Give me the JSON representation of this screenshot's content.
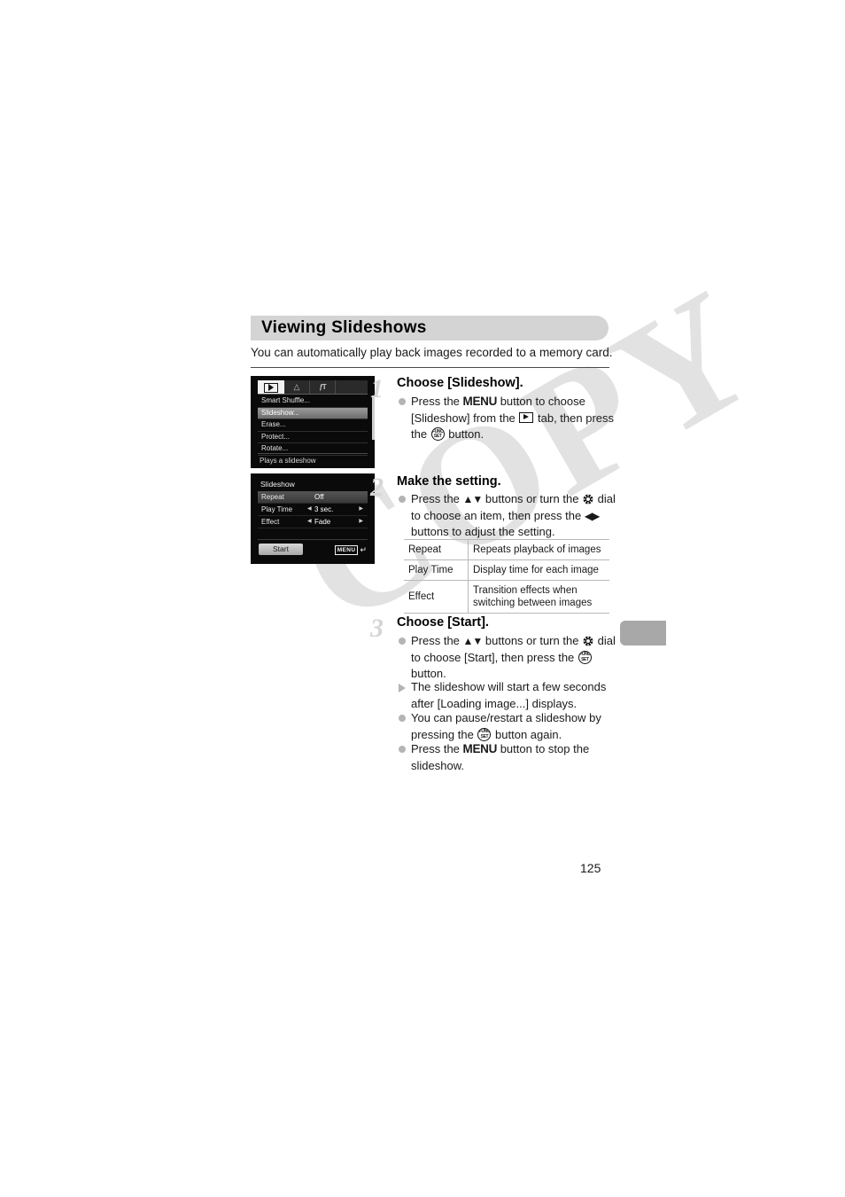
{
  "page": {
    "folio": "125",
    "watermark": "COPY"
  },
  "heading": {
    "title": "Viewing Slideshows",
    "intro": "You can automatically play back images recorded to a memory card."
  },
  "screens": {
    "menu": {
      "tabs": [
        {
          "name": "playback-tab",
          "icon": "play-icon",
          "active": true
        },
        {
          "name": "print-tab",
          "icon": "printer-icon",
          "glyph": "Δ",
          "active": false
        },
        {
          "name": "setup-tab",
          "icon": "wrench-icon",
          "glyph": "ƒT",
          "active": false
        }
      ],
      "items": [
        {
          "label": "Smart Shuffle...",
          "selected": false
        },
        {
          "label": "Slideshow...",
          "selected": true
        },
        {
          "label": "Erase...",
          "selected": false
        },
        {
          "label": "Protect...",
          "selected": false
        },
        {
          "label": "Rotate...",
          "selected": false
        }
      ],
      "hint": "Plays a slideshow"
    },
    "slideshow": {
      "title": "Slideshow",
      "rows": [
        {
          "label": "Repeat",
          "value": "Off",
          "arrows": false,
          "selected": true
        },
        {
          "label": "Play Time",
          "value": "3 sec.",
          "arrows": true,
          "selected": false
        },
        {
          "label": "Effect",
          "value": "Fade",
          "arrows": true,
          "selected": false
        }
      ],
      "start_label": "Start",
      "menu_badge": "MENU",
      "return_glyph": "↵"
    }
  },
  "steps": [
    {
      "num": "1",
      "title": "Choose [Slideshow].",
      "bullets": [
        {
          "kind": "dot",
          "parts": [
            {
              "t": "text",
              "v": "Press the "
            },
            {
              "t": "menu",
              "v": "MENU"
            },
            {
              "t": "text",
              "v": " button to choose [Slideshow] from the "
            },
            {
              "t": "playtab",
              "v": ""
            },
            {
              "t": "text",
              "v": " tab, then press the "
            },
            {
              "t": "func",
              "v": "FUNC. SET"
            },
            {
              "t": "text",
              "v": " button."
            }
          ]
        }
      ]
    },
    {
      "num": "2",
      "title": "Make the setting.",
      "bullets": [
        {
          "kind": "dot",
          "parts": [
            {
              "t": "text",
              "v": "Press the "
            },
            {
              "t": "updown",
              "v": "▲▼"
            },
            {
              "t": "text",
              "v": " buttons or turn the "
            },
            {
              "t": "dial",
              "v": ""
            },
            {
              "t": "text",
              "v": " dial to choose an item, then press the "
            },
            {
              "t": "leftright",
              "v": "◀▶"
            },
            {
              "t": "text",
              "v": " buttons to adjust the setting."
            }
          ]
        }
      ]
    },
    {
      "num": "3",
      "title": "Choose [Start].",
      "bullets": [
        {
          "kind": "dot",
          "parts": [
            {
              "t": "text",
              "v": "Press the "
            },
            {
              "t": "updown",
              "v": "▲▼"
            },
            {
              "t": "text",
              "v": " buttons or turn the "
            },
            {
              "t": "dial",
              "v": ""
            },
            {
              "t": "text",
              "v": " dial to choose [Start], then press the "
            },
            {
              "t": "func",
              "v": "FUNC. SET"
            },
            {
              "t": "text",
              "v": " button."
            }
          ]
        },
        {
          "kind": "triangle",
          "parts": [
            {
              "t": "text",
              "v": "The slideshow will start a few seconds after [Loading image...] displays."
            }
          ]
        },
        {
          "kind": "dot",
          "parts": [
            {
              "t": "text",
              "v": "You can pause/restart a slideshow by pressing the "
            },
            {
              "t": "func",
              "v": "FUNC. SET"
            },
            {
              "t": "text",
              "v": " button again."
            }
          ]
        },
        {
          "kind": "dot",
          "parts": [
            {
              "t": "text",
              "v": "Press the "
            },
            {
              "t": "menu",
              "v": "MENU"
            },
            {
              "t": "text",
              "v": " button to stop the slideshow."
            }
          ]
        }
      ]
    }
  ],
  "spec_table": {
    "rows": [
      {
        "key": "Repeat",
        "desc": "Repeats playback of images"
      },
      {
        "key": "Play Time",
        "desc": "Display time for each image"
      },
      {
        "key": "Effect",
        "desc": "Transition effects when switching between images"
      }
    ]
  }
}
